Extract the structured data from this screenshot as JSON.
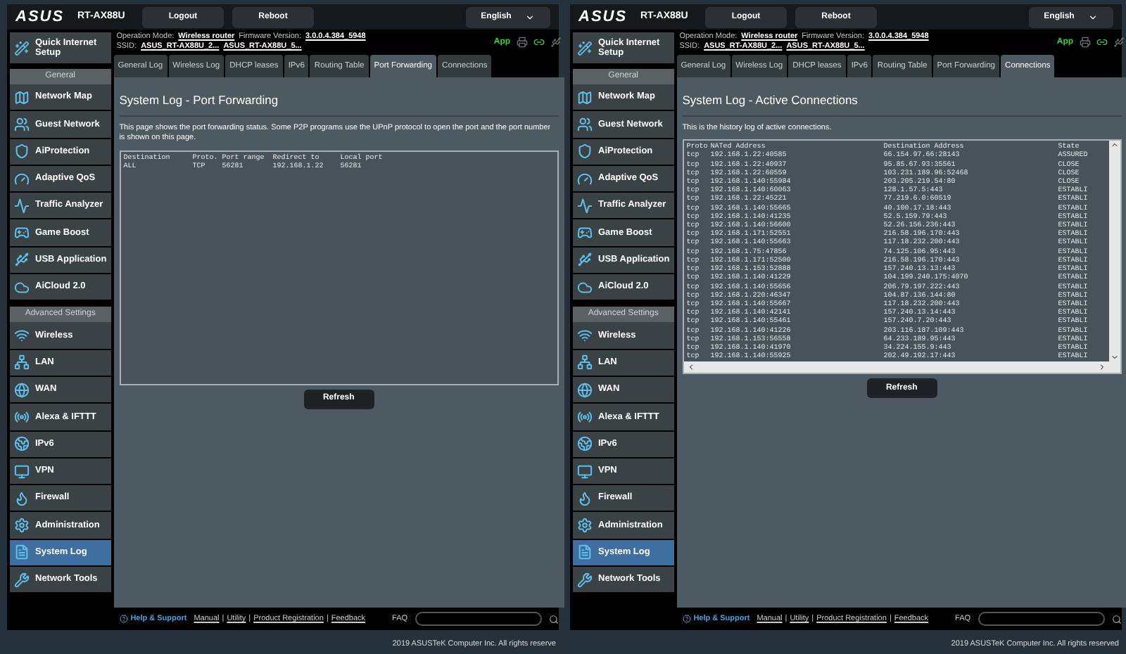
{
  "panels": [
    {
      "brand": "ASUS",
      "model": "RT-AX88U",
      "header_buttons": [
        "Logout",
        "Reboot"
      ],
      "language": "English",
      "operation_mode_label": "Operation Mode:",
      "operation_mode": "Wireless router",
      "firmware_label": "Firmware Version:",
      "firmware": "3.0.0.4.384_5948",
      "ssid_label": "SSID:",
      "ssids": [
        "ASUS_RT-AX88U_2...",
        "ASUS_RT-AX88U_5..."
      ],
      "app_label": "App",
      "quick_setup": "Quick Internet Setup",
      "general_heading": "General",
      "general_items": [
        {
          "label": "Network Map",
          "selected": false
        },
        {
          "label": "Guest Network",
          "selected": false
        },
        {
          "label": "AiProtection",
          "selected": false
        },
        {
          "label": "Adaptive QoS",
          "selected": false
        },
        {
          "label": "Traffic Analyzer",
          "selected": false
        },
        {
          "label": "Game Boost",
          "selected": false
        },
        {
          "label": "USB Application",
          "selected": false
        },
        {
          "label": "AiCloud 2.0",
          "selected": false
        }
      ],
      "advanced_heading": "Advanced Settings",
      "advanced_items": [
        {
          "label": "Wireless",
          "selected": false
        },
        {
          "label": "LAN",
          "selected": false
        },
        {
          "label": "WAN",
          "selected": false
        },
        {
          "label": "Alexa & IFTTT",
          "selected": false
        },
        {
          "label": "IPv6",
          "selected": false
        },
        {
          "label": "VPN",
          "selected": false
        },
        {
          "label": "Firewall",
          "selected": false
        },
        {
          "label": "Administration",
          "selected": false
        },
        {
          "label": "System Log",
          "selected": true
        },
        {
          "label": "Network Tools",
          "selected": false
        }
      ],
      "tabs": [
        {
          "label": "General Log",
          "selected": false
        },
        {
          "label": "Wireless Log",
          "selected": false
        },
        {
          "label": "DHCP leases",
          "selected": false
        },
        {
          "label": "IPv6",
          "selected": false
        },
        {
          "label": "Routing Table",
          "selected": false
        },
        {
          "label": "Port Forwarding",
          "selected": true
        },
        {
          "label": "Connections",
          "selected": false
        }
      ],
      "title": "System Log - Port Forwarding",
      "description": "This page shows the port forwarding status. Some P2P programs use the UPnP protocol to open the port and the port number is shown on this page.",
      "log": {
        "kind": "plain",
        "columns": [
          "Destination",
          "Proto.",
          "Port range",
          "Redirect to",
          "Local port"
        ],
        "rows": [
          [
            "ALL",
            "TCP",
            "56281",
            "192.168.1.22",
            "56281"
          ]
        ]
      },
      "refresh": "Refresh",
      "help": "Help & Support",
      "links": [
        "Manual",
        "Utility",
        "Product Registration",
        "Feedback"
      ],
      "separator": "|",
      "faq": "FAQ",
      "copyright": "2019 ASUSTeK Computer Inc. All rights reserve"
    },
    {
      "brand": "ASUS",
      "model": "RT-AX88U",
      "header_buttons": [
        "Logout",
        "Reboot"
      ],
      "language": "English",
      "operation_mode_label": "Operation Mode:",
      "operation_mode": "Wireless router",
      "firmware_label": "Firmware Version:",
      "firmware": "3.0.0.4.384_5948",
      "ssid_label": "SSID:",
      "ssids": [
        "ASUS_RT-AX88U_2...",
        "ASUS_RT-AX88U_5..."
      ],
      "app_label": "App",
      "quick_setup": "Quick Internet Setup",
      "general_heading": "General",
      "general_items": [
        {
          "label": "Network Map",
          "selected": false
        },
        {
          "label": "Guest Network",
          "selected": false
        },
        {
          "label": "AiProtection",
          "selected": false
        },
        {
          "label": "Adaptive QoS",
          "selected": false
        },
        {
          "label": "Traffic Analyzer",
          "selected": false
        },
        {
          "label": "Game Boost",
          "selected": false
        },
        {
          "label": "USB Application",
          "selected": false
        },
        {
          "label": "AiCloud 2.0",
          "selected": false
        }
      ],
      "advanced_heading": "Advanced Settings",
      "advanced_items": [
        {
          "label": "Wireless",
          "selected": false
        },
        {
          "label": "LAN",
          "selected": false
        },
        {
          "label": "WAN",
          "selected": false
        },
        {
          "label": "Alexa & IFTTT",
          "selected": false
        },
        {
          "label": "IPv6",
          "selected": false
        },
        {
          "label": "VPN",
          "selected": false
        },
        {
          "label": "Firewall",
          "selected": false
        },
        {
          "label": "Administration",
          "selected": false
        },
        {
          "label": "System Log",
          "selected": true
        },
        {
          "label": "Network Tools",
          "selected": false
        }
      ],
      "tabs": [
        {
          "label": "General Log",
          "selected": false
        },
        {
          "label": "Wireless Log",
          "selected": false
        },
        {
          "label": "DHCP leases",
          "selected": false
        },
        {
          "label": "IPv6",
          "selected": false
        },
        {
          "label": "Routing Table",
          "selected": false
        },
        {
          "label": "Port Forwarding",
          "selected": false
        },
        {
          "label": "Connections",
          "selected": true
        }
      ],
      "title": "System Log - Active Connections",
      "description": "This is the history log of active connections.",
      "log": {
        "kind": "scroll",
        "columns": [
          "Proto",
          "NATed Address",
          "Destination Address",
          "State"
        ],
        "rows": [
          [
            "tcp",
            "192.168.1.22:40585",
            "66.154.97.66:28143",
            "ASSURED"
          ],
          [
            "tcp",
            "192.168.1.22:40937",
            "95.85.67.93:35561",
            "CLOSE"
          ],
          [
            "tcp",
            "192.168.1.22:60559",
            "103.231.189.96:52468",
            "CLOSE"
          ],
          [
            "tcp",
            "192.168.1.140:55984",
            "203.205.219.54:80",
            "CLOSE"
          ],
          [
            "tcp",
            "192.168.1.140:60063",
            "128.1.57.5:443",
            "ESTABLI"
          ],
          [
            "tcp",
            "192.168.1.22:45221",
            "77.219.6.0:60519",
            "ESTABLI"
          ],
          [
            "tcp",
            "192.168.1.140:55665",
            "40.100.17.18:443",
            "ESTABLI"
          ],
          [
            "tcp",
            "192.168.1.140:41235",
            "52.5.159.79:443",
            "ESTABLI"
          ],
          [
            "tcp",
            "192.168.1.140:56600",
            "52.26.156.236:443",
            "ESTABLI"
          ],
          [
            "tcp",
            "192.168.1.171:52551",
            "216.58.196.170:443",
            "ESTABLI"
          ],
          [
            "tcp",
            "192.168.1.140:55663",
            "117.18.232.200:443",
            "ESTABLI"
          ],
          [
            "tcp",
            "192.168.1.75:47856",
            "74.125.106.95:443",
            "ESTABLI"
          ],
          [
            "tcp",
            "192.168.1.171:52500",
            "216.58.196.170:443",
            "ESTABLI"
          ],
          [
            "tcp",
            "192.168.1.153:52888",
            "157.240.13.13:443",
            "ESTABLI"
          ],
          [
            "tcp",
            "192.168.1.140:41229",
            "104.199.240.175:4070",
            "ESTABLI"
          ],
          [
            "tcp",
            "192.168.1.140:55656",
            "206.79.197.222:443",
            "ESTABLI"
          ],
          [
            "tcp",
            "192.168.1.220:46347",
            "104.87.136.144:80",
            "ESTABLI"
          ],
          [
            "tcp",
            "192.168.1.140:55667",
            "117.18.232.200:443",
            "ESTABLI"
          ],
          [
            "tcp",
            "192.168.1.140:42141",
            "157.240.13.14:443",
            "ESTABLI"
          ],
          [
            "tcp",
            "192.168.1.140:55461",
            "157.240.7.20:443",
            "ESTABLI"
          ],
          [
            "tcp",
            "192.168.1.140:41226",
            "203.116.187.109:443",
            "ESTABLI"
          ],
          [
            "tcp",
            "192.168.1.153:56558",
            "64.233.189.95:443",
            "ESTABLI"
          ],
          [
            "tcp",
            "192.168.1.140:41970",
            "34.224.155.9:443",
            "ESTABLI"
          ],
          [
            "tcp",
            "192.168.1.140:55925",
            "202.49.192.17:443",
            "ESTABLI"
          ]
        ]
      },
      "refresh": "Refresh",
      "help": "Help & Support",
      "links": [
        "Manual",
        "Utility",
        "Product Registration",
        "Feedback"
      ],
      "separator": "|",
      "faq": "FAQ",
      "copyright": "2019 ASUSTeK Computer Inc. All rights reserved"
    }
  ]
}
